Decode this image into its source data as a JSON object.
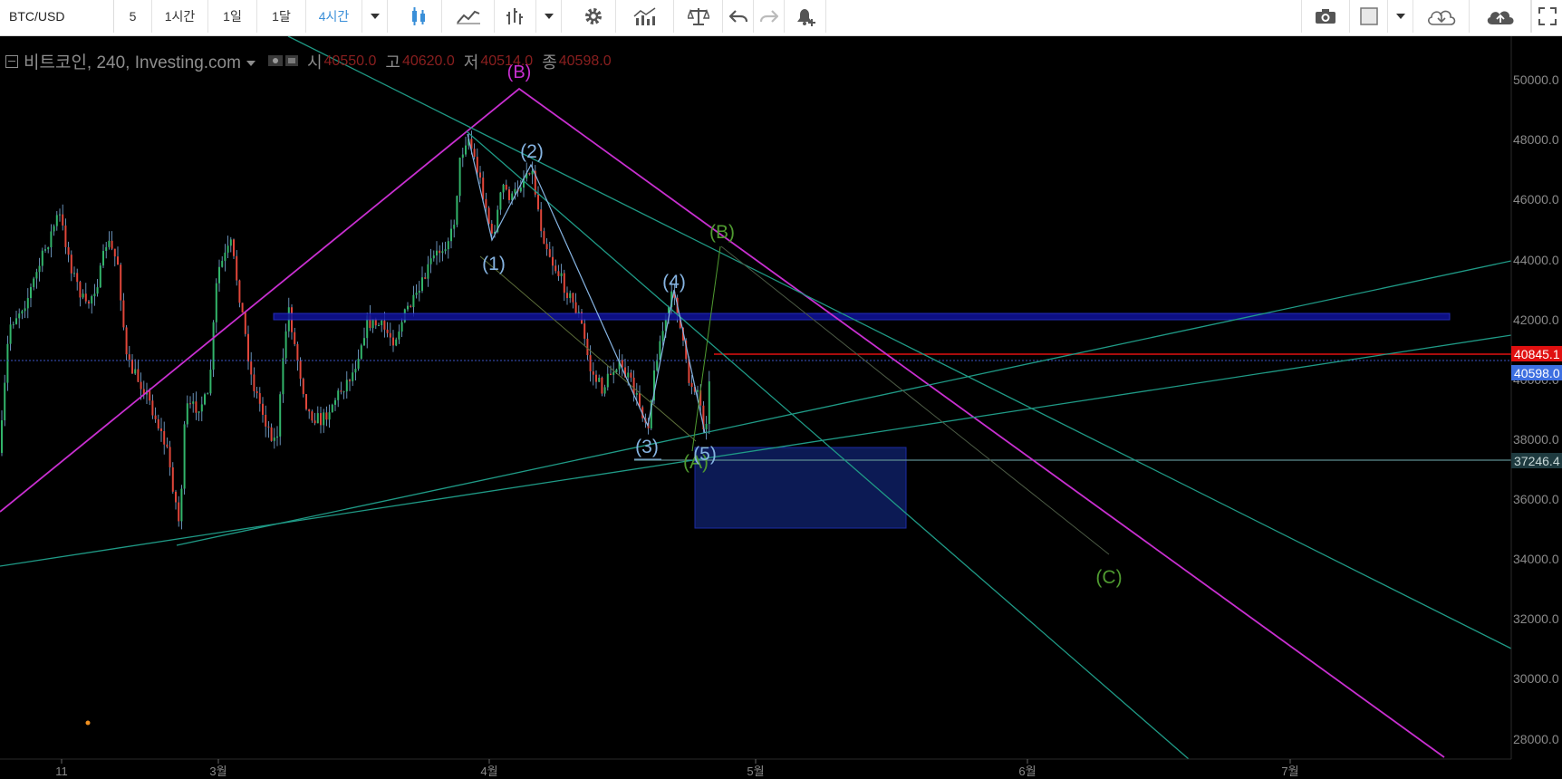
{
  "toolbar": {
    "symbol": "BTC/USD",
    "intervals": [
      "5",
      "1시간",
      "1일",
      "1달",
      "4시간"
    ],
    "active_interval": "4시간"
  },
  "legend": {
    "title": "비트코인, 240, Investing.com",
    "open_label": "시",
    "open": "40550.0",
    "high_label": "고",
    "high": "40620.0",
    "low_label": "저",
    "low": "40514.0",
    "close_label": "종",
    "close": "40598.0"
  },
  "price_axis": {
    "ticks": [
      "50000.0",
      "48000.0",
      "46000.0",
      "44000.0",
      "42000.0",
      "40000.0",
      "38000.0",
      "36000.0",
      "34000.0",
      "32000.0",
      "30000.0",
      "28000.0"
    ],
    "badges": [
      {
        "value": "40845.1",
        "color": "#e01010"
      },
      {
        "value": "40598.0",
        "color": "#3d6fe0"
      },
      {
        "value": "37246.4",
        "color": "#1e3a3f"
      }
    ]
  },
  "time_axis": {
    "ticks": [
      "11",
      "3월",
      "4월",
      "5월",
      "6월",
      "7월"
    ]
  },
  "wave_labels": {
    "B_major": "(B)",
    "w1": "(1)",
    "w2": "(2)",
    "w3": "(3)",
    "w4": "(4)",
    "w5": "(5)",
    "A": "(A)",
    "B_minor": "(B)",
    "C": "(C)"
  },
  "colors": {
    "up": "#32b46a",
    "down": "#e0463a",
    "magenta": "#c82fd0",
    "teal": "#1f9a86",
    "wave": "#86b4e2",
    "green_label": "#4f9a30"
  }
}
